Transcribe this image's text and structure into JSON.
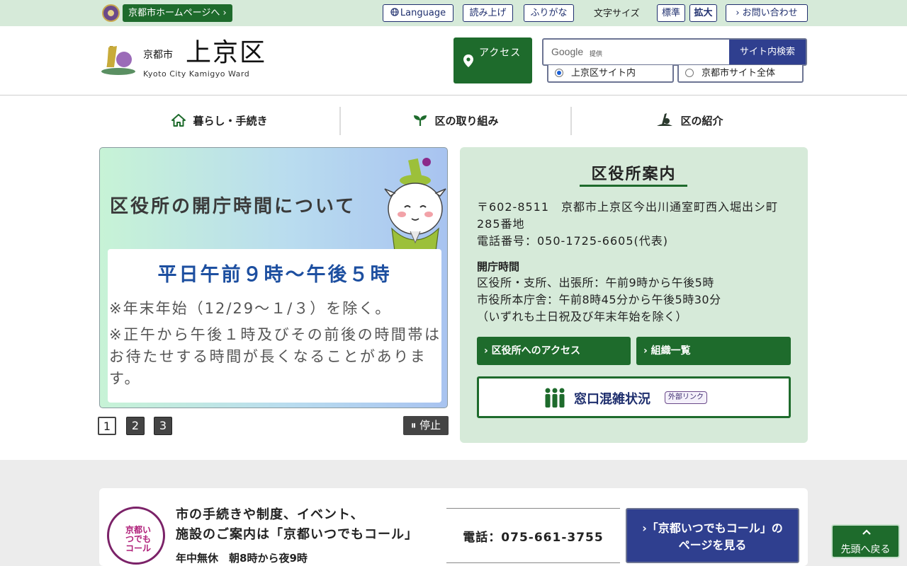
{
  "topbar": {
    "home_link": "京都市ホームページへ ›",
    "language": "Language",
    "read_aloud": "読み上げ",
    "furigana": "ふりがな",
    "font_size_label": "文字サイズ",
    "font_standard": "標準",
    "font_large": "拡大",
    "contact": "› お問い合わせ"
  },
  "header": {
    "logo_city": "京都市",
    "logo_ward": "上京区",
    "logo_en": "Kyoto City Kamigyo Ward",
    "access_label": "アクセス",
    "search": {
      "google": "Google",
      "google_sub": "提供",
      "button": "サイト内検索",
      "options": [
        "上京区サイト内",
        "京都市サイト全体"
      ],
      "selected": "上京区サイト内"
    }
  },
  "nav": [
    "暮らし・手続き",
    "区の取り組み",
    "区の紹介"
  ],
  "slider": {
    "title": "区役所の開庁時間について",
    "hours": "平日午前９時～午後５時",
    "note1": "※年末年始（12/29～１/３）を除く。",
    "note2": "※正午から午後１時及びその前後の時間帯はお待たせする時間が長くなることがあります。",
    "pages": [
      "1",
      "2",
      "3"
    ],
    "current_page": "1",
    "stop": "⏸ 停止"
  },
  "office": {
    "title": "区役所案内",
    "address": "〒602-8511　京都市上京区今出川通室町西入堀出シ町285番地",
    "phone": "電話番号：050-1725-6605(代表)",
    "hours_heading": "開庁時間",
    "hours_lines": [
      "区役所・支所、出張所：午前9時から午後5時",
      "市役所本庁舎：午前8時45分から午後5時30分",
      "（いずれも土日祝及び年末年始を除く）"
    ],
    "access_button": "› 区役所へのアクセス",
    "org_button": "› 組織一覧",
    "congestion_label": "窓口混雑状況",
    "external_badge": "外部リンク"
  },
  "call": {
    "logo_text": "京都いつでもコール",
    "text_line1": "市の手続きや制度、イベント、",
    "text_line2": "施設のご案内は「京都いつでもコール」",
    "sub": "年中無休　朝8時から夜9時",
    "phone": "電話：075-661-3755",
    "button_line1": "›「京都いつでもコール」の",
    "button_line2": "ページを見る"
  },
  "page_top": "先頭へ戻る",
  "colors": {
    "brand_green": "#1e6b2c",
    "light_green": "#d6ead9",
    "navy": "#2f3f8f",
    "purple": "#6b4a8a"
  }
}
